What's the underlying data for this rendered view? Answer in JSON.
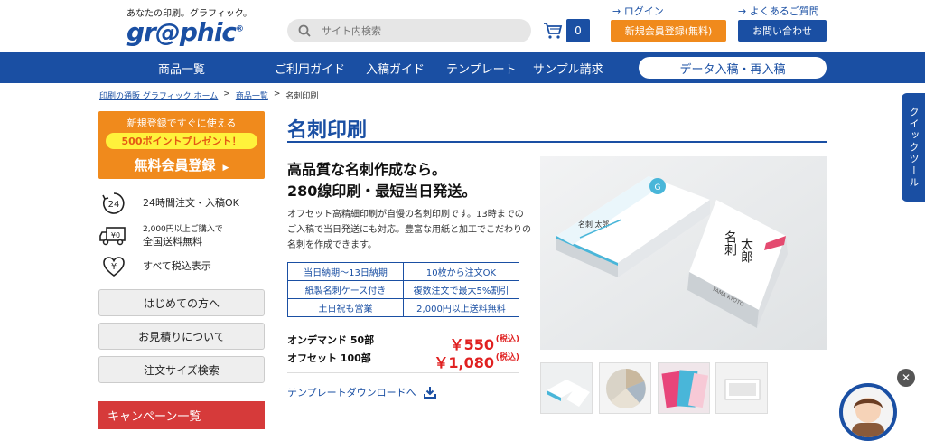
{
  "header": {
    "tagline": "あなたの印刷。グラフィック。",
    "logo": "gr@phic",
    "search_placeholder": "サイト内検索",
    "cart_count": "0",
    "login": "ログイン",
    "faq": "よくあるご質問",
    "register": "新規会員登録(無料)",
    "contact": "お問い合わせ"
  },
  "nav": {
    "items": [
      "商品一覧",
      "ご利用ガイド",
      "入稿ガイド",
      "テンプレート",
      "サンプル請求"
    ],
    "data_entry": "データ入稿・再入稿"
  },
  "breadcrumb": {
    "home": "印刷の通販 グラフィック ホーム",
    "products": "商品一覧",
    "current": "名刺印刷"
  },
  "sidebar": {
    "promo_top": "新規登録ですぐに使える",
    "promo_points": "500ポイントプレゼント！",
    "promo_main": "無料会員登録",
    "features": [
      {
        "text": "24時間注文・入稿OK",
        "icon_label": "24"
      },
      {
        "small": "2,000円以上ご購入で",
        "text": "全国送料無料",
        "icon_label": "¥0"
      },
      {
        "text": "すべて税込表示",
        "icon_label": "¥"
      }
    ],
    "buttons": [
      "はじめての方へ",
      "お見積りについて",
      "注文サイズ検索"
    ],
    "campaign": "キャンペーン一覧"
  },
  "product": {
    "title": "名刺印刷",
    "headline1": "高品質な名刺作成なら。",
    "headline2": "280線印刷・最短当日発送。",
    "desc": "オフセット高精細印刷が自慢の名刺印刷です。13時までのご入稿で当日発送にも対応。豊富な用紙と加工でこだわりの名刺を作成できます。",
    "table": [
      [
        "当日納期〜13日納期",
        "10枚から注文OK"
      ],
      [
        "紙製名刺ケース付き",
        "複数注文で最大5%割引"
      ],
      [
        "土日祝も営業",
        "2,000円以上送料無料"
      ]
    ],
    "prices": [
      {
        "label": "オンデマンド 50部",
        "price": "￥550",
        "tax": "(税込)"
      },
      {
        "label": "オフセット 100部",
        "price": "￥1,080",
        "tax": "(税込)"
      }
    ],
    "template_link": "テンプレートダウンロードへ",
    "card_name": "名刺 太郎",
    "card_roman": "YAMA KYOTO"
  },
  "floating": {
    "quick_tool": "クイックツール",
    "close": "✕"
  }
}
